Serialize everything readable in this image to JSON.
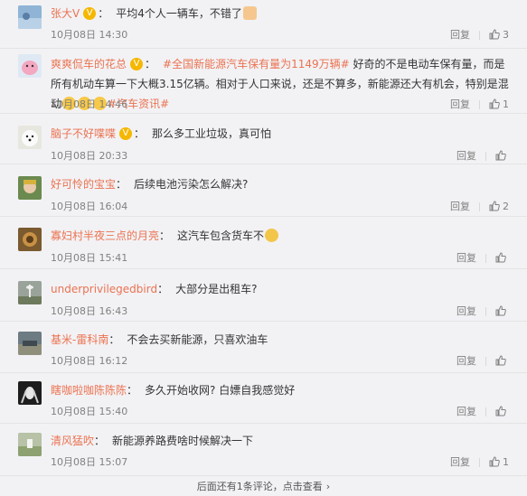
{
  "comments": [
    {
      "user": "张大V",
      "verified": true,
      "sep": "：",
      "text": "平均4个人一辆车，不错了",
      "emoji": "thumb",
      "time": "10月08日 14:30",
      "reply": "回复",
      "likes": "3"
    },
    {
      "user": "爽爽侃车的花总",
      "verified": true,
      "sep": "：",
      "tag1": "#全国新能源汽车保有量为1149万辆#",
      "text": " 好奇的不是电动车保有量，而是所有机动车算一下大概3.15亿辆。相对于人口来说，还是不算多，新能源还大有机会，特别是混动",
      "tag2": "#汽车资讯#",
      "time": "10月08日 14:46",
      "reply": "回复",
      "likes": "1"
    },
    {
      "user": "脑子不好喋喋",
      "verified": true,
      "sep": "：",
      "text": "那么多工业垃圾，真可怕",
      "time": "10月08日 20:33",
      "reply": "回复",
      "likes": "赞"
    },
    {
      "user": "好可怜的宝宝",
      "verified": false,
      "sep": "：",
      "text": "后续电池污染怎么解决?",
      "time": "10月08日 16:04",
      "reply": "回复",
      "likes": "2"
    },
    {
      "user": "寡妇村半夜三点的月亮",
      "verified": false,
      "sep": "：",
      "text": "这汽车包含货车不",
      "emoji": "rolling",
      "time": "10月08日 15:41",
      "reply": "回复",
      "likes": "赞"
    },
    {
      "user": "underprivilegedbird",
      "verified": false,
      "sep": "：",
      "text": "大部分是出租车?",
      "time": "10月08日 16:43",
      "reply": "回复",
      "likes": "赞"
    },
    {
      "user": "基米-雷科南",
      "verified": false,
      "sep": "：",
      "text": "不会去买新能源，只喜欢油车",
      "time": "10月08日 16:12",
      "reply": "回复",
      "likes": "赞"
    },
    {
      "user": "瞎咖啦咖陈陈陈",
      "verified": false,
      "sep": "：",
      "text": "多久开始收网? 白嫖自我感觉好",
      "time": "10月08日 15:40",
      "reply": "回复",
      "likes": "赞"
    },
    {
      "user": "清风猛吹",
      "verified": false,
      "sep": "：",
      "text": "新能源养路费啥时候解决一下",
      "time": "10月08日 15:07",
      "reply": "回复",
      "likes": "1"
    }
  ],
  "footer": {
    "text": "后面还有1条评论，点击查看",
    "chevron": "›"
  }
}
